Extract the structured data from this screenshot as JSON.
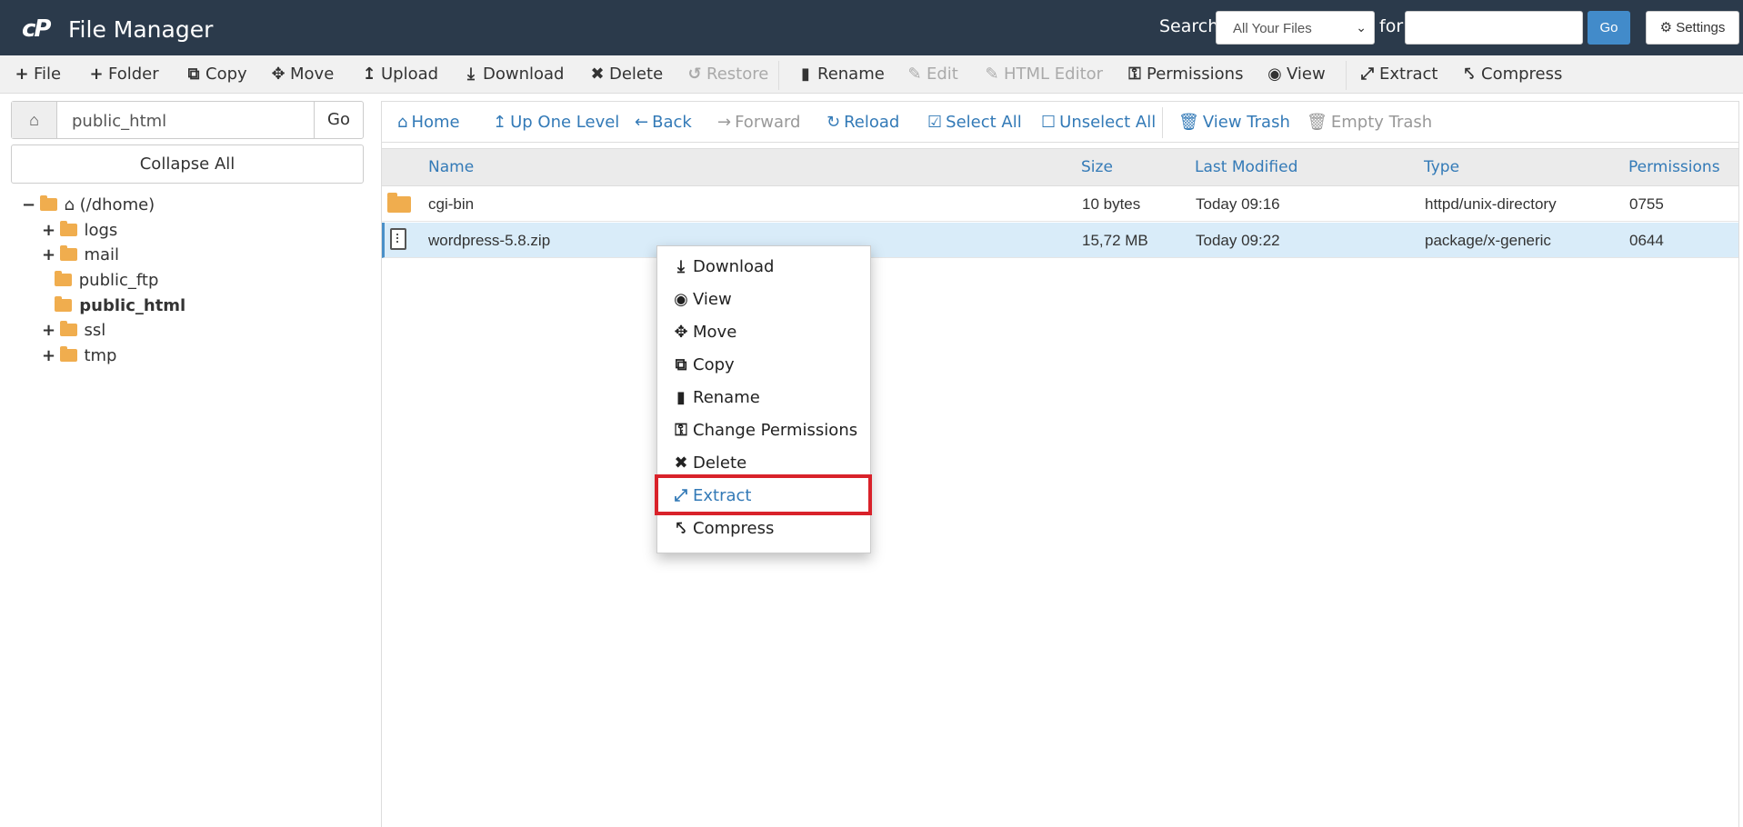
{
  "header": {
    "logo_text": "cP",
    "title": "File Manager",
    "search_label": "Search",
    "search_scope": "All Your Files",
    "for_label": "for",
    "search_value": "",
    "go_label": "Go",
    "settings_label": "Settings"
  },
  "toolbar": [
    {
      "label": "File",
      "icon": "plus-icon",
      "disabled": false
    },
    {
      "label": "Folder",
      "icon": "plus-icon",
      "disabled": false
    },
    {
      "label": "Copy",
      "icon": "copy-icon",
      "disabled": false
    },
    {
      "label": "Move",
      "icon": "move-icon",
      "disabled": false
    },
    {
      "label": "Upload",
      "icon": "upload-icon",
      "disabled": false
    },
    {
      "label": "Download",
      "icon": "download-icon",
      "disabled": false
    },
    {
      "label": "Delete",
      "icon": "x-icon",
      "disabled": false
    },
    {
      "label": "Restore",
      "icon": "undo-icon",
      "disabled": true
    },
    {
      "label": "Rename",
      "icon": "file-icon",
      "disabled": false
    },
    {
      "label": "Edit",
      "icon": "pencil-icon",
      "disabled": true
    },
    {
      "label": "HTML Editor",
      "icon": "edit-icon",
      "disabled": true
    },
    {
      "label": "Permissions",
      "icon": "key-icon",
      "disabled": false
    },
    {
      "label": "View",
      "icon": "eye-icon",
      "disabled": false
    },
    {
      "label": "Extract",
      "icon": "expand-icon",
      "disabled": false
    },
    {
      "label": "Compress",
      "icon": "compress-icon",
      "disabled": false
    }
  ],
  "sidebar": {
    "path_value": "public_html",
    "go_label": "Go",
    "collapse_label": "Collapse All",
    "tree": [
      {
        "label": "(/dhome)",
        "expander": "−",
        "type": "home"
      },
      {
        "label": "logs",
        "expander": "+",
        "type": "folder"
      },
      {
        "label": "mail",
        "expander": "+",
        "type": "folder"
      },
      {
        "label": "public_ftp",
        "expander": "",
        "type": "folder"
      },
      {
        "label": "public_html",
        "expander": "",
        "type": "folder",
        "bold": true
      },
      {
        "label": "ssl",
        "expander": "+",
        "type": "folder"
      },
      {
        "label": "tmp",
        "expander": "+",
        "type": "folder"
      }
    ]
  },
  "nav": [
    {
      "label": "Home",
      "icon": "home-icon",
      "disabled": false
    },
    {
      "label": "Up One Level",
      "icon": "level-up-icon",
      "disabled": false
    },
    {
      "label": "Back",
      "icon": "arrow-left-icon",
      "disabled": false
    },
    {
      "label": "Forward",
      "icon": "arrow-right-icon",
      "disabled": true
    },
    {
      "label": "Reload",
      "icon": "refresh-icon",
      "disabled": false
    },
    {
      "label": "Select All",
      "icon": "check-square-icon",
      "disabled": false
    },
    {
      "label": "Unselect All",
      "icon": "square-icon",
      "disabled": false
    },
    {
      "label": "View Trash",
      "icon": "trash-icon",
      "disabled": false
    },
    {
      "label": "Empty Trash",
      "icon": "trash-icon",
      "disabled": true
    }
  ],
  "table": {
    "columns": [
      "Name",
      "Size",
      "Last Modified",
      "Type",
      "Permissions"
    ],
    "rows": [
      {
        "name": "cgi-bin",
        "size": "10 bytes",
        "modified": "Today 09:16",
        "type": "httpd/unix-directory",
        "perms": "0755",
        "icon": "folder-icon",
        "selected": false
      },
      {
        "name": "wordpress-5.8.zip",
        "size": "15,72 MB",
        "modified": "Today 09:22",
        "type": "package/x-generic",
        "perms": "0644",
        "icon": "zip-file-icon",
        "selected": true
      }
    ]
  },
  "context_menu": [
    {
      "label": "Download",
      "icon": "download-icon"
    },
    {
      "label": "View",
      "icon": "eye-icon"
    },
    {
      "label": "Move",
      "icon": "move-icon"
    },
    {
      "label": "Copy",
      "icon": "copy-icon"
    },
    {
      "label": "Rename",
      "icon": "file-icon"
    },
    {
      "label": "Change Permissions",
      "icon": "key-icon"
    },
    {
      "label": "Delete",
      "icon": "x-icon"
    },
    {
      "label": "Extract",
      "icon": "expand-icon",
      "highlighted": true
    },
    {
      "label": "Compress",
      "icon": "compress-icon"
    }
  ],
  "colors": {
    "header_bg": "#2b3a4b",
    "link": "#337ab7",
    "selected_row": "#d9ecf9",
    "highlight_border": "#d9222a",
    "folder": "#f0ad4e"
  }
}
